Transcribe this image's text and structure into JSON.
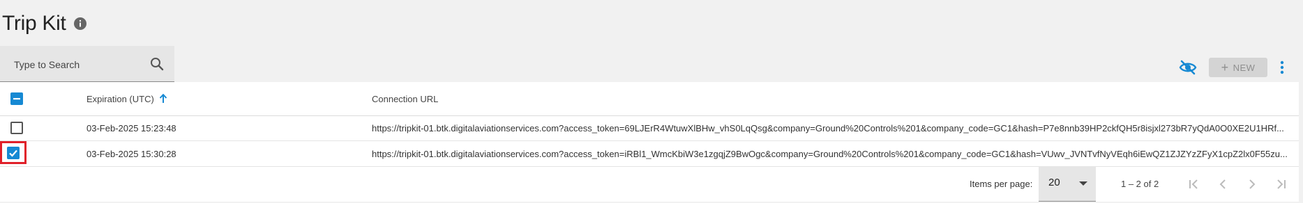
{
  "page": {
    "title": "Trip Kit"
  },
  "icons": {
    "info": "info-icon",
    "search": "search-icon",
    "hide_columns": "eye-off-icon",
    "more": "kebab-menu-icon",
    "sort": "arrow-up-icon",
    "first": "first-page-icon",
    "prev": "previous-page-icon",
    "next": "next-page-icon",
    "last": "last-page-icon"
  },
  "colors": {
    "accent": "#1689d3",
    "highlight": "#e0202a",
    "disabled": "#8e8e8e"
  },
  "toolbar": {
    "search_placeholder": "Type to Search",
    "new_label": "NEW",
    "new_enabled": false
  },
  "table": {
    "columns": [
      "Expiration (UTC)",
      "Connection URL"
    ],
    "sort": {
      "column": "Expiration (UTC)",
      "direction": "ascending"
    },
    "select_all_state": "indeterminate",
    "rows": [
      {
        "selected": false,
        "expiration": "03-Feb-2025 15:23:48",
        "url": "https://tripkit-01.btk.digitalaviationservices.com?access_token=69LJErR4WtuwXlBHw_vhS0LqQsg&company=Ground%20Controls%201&company_code=GC1&hash=P7e8nnb39HP2ckfQH5r8isjxl273bR7yQdA0O0XE2U1HRf..."
      },
      {
        "selected": true,
        "expiration": "03-Feb-2025 15:30:28",
        "url": "https://tripkit-01.btk.digitalaviationservices.com?access_token=iRBl1_WmcKbiW3e1zgqjZ9BwOgc&company=Ground%20Controls%201&company_code=GC1&hash=VUwv_JVNTvfNyVEqh6iEwQZ1ZJZYzZFyX1cpZ2lx0F55zu..."
      }
    ]
  },
  "pagination": {
    "items_per_page_label": "Items per page:",
    "items_per_page": "20",
    "range": "1 – 2 of 2"
  }
}
